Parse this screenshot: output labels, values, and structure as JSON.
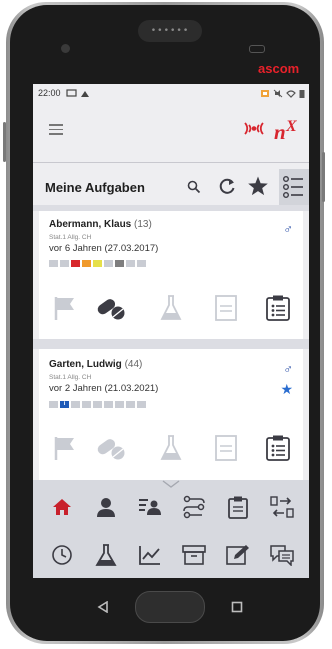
{
  "device": {
    "brand": "ascom",
    "speaker_dots": "••••••"
  },
  "status_bar": {
    "time": "22:00"
  },
  "app": {
    "logo_text": "nX"
  },
  "tasks": {
    "title": "Meine Aufgaben"
  },
  "patients": [
    {
      "name": "Abermann, Klaus",
      "age": "(13)",
      "station": "Stat.1 Allg. CH",
      "since": "vor 6 Jahren (27.03.2017)",
      "gender": "♂",
      "favorite": false,
      "squares": [
        "#c9ccd3",
        "#c9ccd3",
        "#d7272b",
        "#f09a2c",
        "#e6e04a",
        "#c9ccd3",
        "#7e7e7e",
        "#c9ccd3",
        "#c9ccd3"
      ]
    },
    {
      "name": "Garten, Ludwig",
      "age": "(44)",
      "station": "Stat.1 Allg. CH",
      "since": "vor 2 Jahren (21.03.2021)",
      "gender": "♂",
      "favorite": true,
      "squares": [
        "#c9ccd3",
        "#1f5bb8",
        "#c9ccd3",
        "#c9ccd3",
        "#c9ccd3",
        "#c9ccd3",
        "#c9ccd3",
        "#c9ccd3",
        "#c9ccd3"
      ]
    }
  ],
  "colors": {
    "accent_red": "#c8202b",
    "nav_bg": "#d7d9df",
    "icon_dark": "#3c3c44",
    "icon_light": "#c9ccd3",
    "gender_blue": "#2a4fa6"
  }
}
